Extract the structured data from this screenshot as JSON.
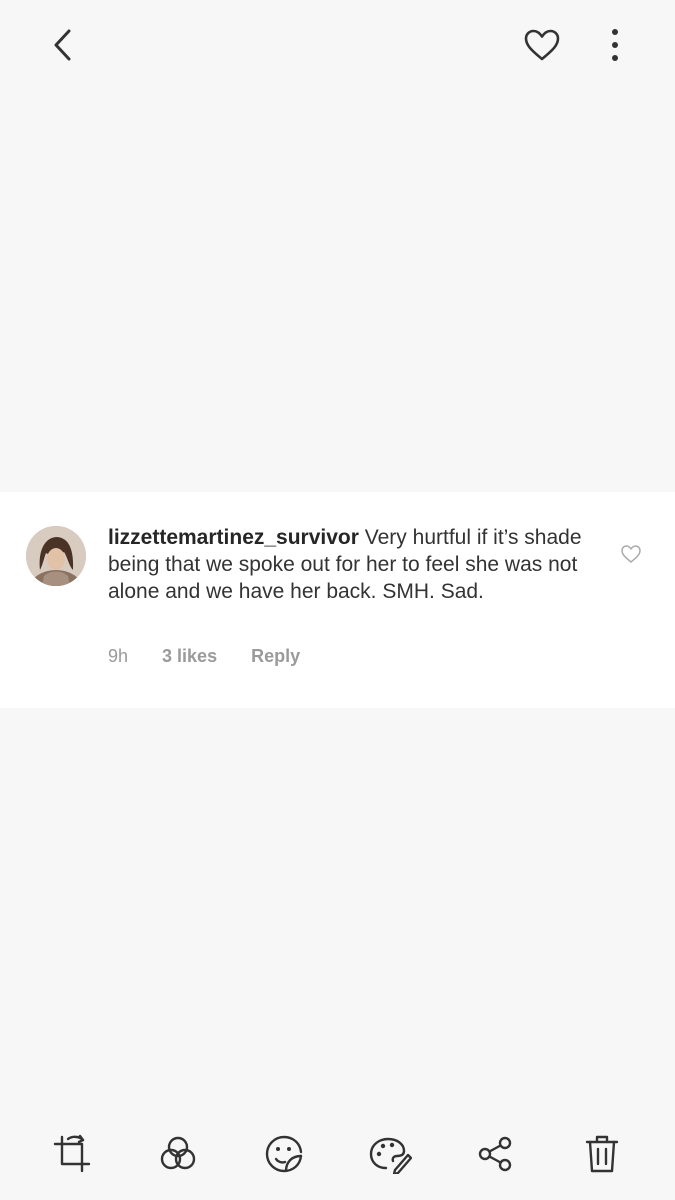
{
  "icons": {
    "back": "chevron-left-icon",
    "favorite": "heart-outline-icon",
    "more": "vertical-ellipsis-icon",
    "comment_like": "heart-outline-icon",
    "toolbar": [
      "crop-rotate-icon",
      "filters-icon",
      "sticker-icon",
      "palette-pen-icon",
      "share-icon",
      "trash-icon"
    ]
  },
  "comment": {
    "username": "lizzettemartinez_survivor",
    "text": "Very hurtful if it’s shade being that we spoke out for her to feel she was not alone and we have her back. SMH. Sad.",
    "time": "9h",
    "likes": "3 likes",
    "reply_label": "Reply"
  },
  "colors": {
    "background": "#f7f7f8",
    "card": "#ffffff",
    "icon": "#333333",
    "meta_text": "#9a9a9a"
  }
}
